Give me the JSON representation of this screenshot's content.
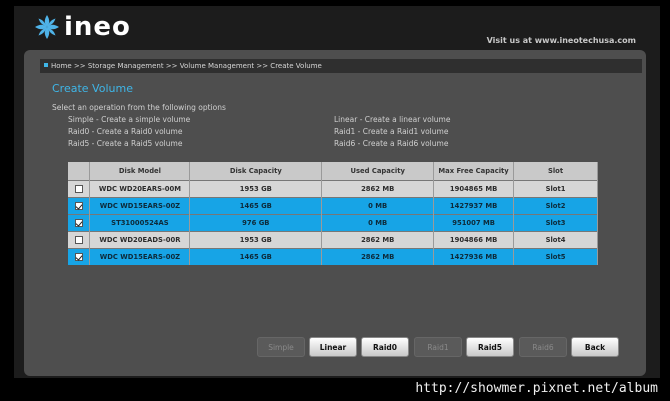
{
  "brand": {
    "logo_text": "ineo",
    "visit_text": "Visit us at www.ineotechusa.com"
  },
  "breadcrumb": "Home >> Storage Management >> Volume Management >> Create Volume",
  "page_title": "Create Volume",
  "instruction": "Select an operation from the following options",
  "options": {
    "simple": "Simple - Create a simple volume",
    "raid0": "Raid0 - Create a Raid0 volume",
    "raid5": "Raid5 - Create a Raid5 volume",
    "linear": "Linear - Create a linear volume",
    "raid1": "Raid1 - Create a Raid1 volume",
    "raid6": "Raid6 - Create a Raid6 volume"
  },
  "table": {
    "headers": [
      "Disk Model",
      "Disk Capacity",
      "Used Capacity",
      "Max Free Capacity",
      "Slot"
    ],
    "rows": [
      {
        "checked": false,
        "model": "WDC WD20EARS-00M",
        "capacity": "1953 GB",
        "used": "2862 MB",
        "free": "1904865 MB",
        "slot": "Slot1"
      },
      {
        "checked": true,
        "model": "WDC WD15EARS-00Z",
        "capacity": "1465 GB",
        "used": "0 MB",
        "free": "1427937 MB",
        "slot": "Slot2"
      },
      {
        "checked": true,
        "model": "ST31000524AS",
        "capacity": "976 GB",
        "used": "0 MB",
        "free": "951007 MB",
        "slot": "Slot3"
      },
      {
        "checked": false,
        "model": "WDC WD20EADS-00R",
        "capacity": "1953 GB",
        "used": "2862 MB",
        "free": "1904866 MB",
        "slot": "Slot4"
      },
      {
        "checked": true,
        "model": "WDC WD15EARS-00Z",
        "capacity": "1465 GB",
        "used": "2862 MB",
        "free": "1427936 MB",
        "slot": "Slot5"
      }
    ]
  },
  "buttons": {
    "simple": "Simple",
    "linear": "Linear",
    "raid0": "Raid0",
    "raid1": "Raid1",
    "raid5": "Raid5",
    "raid6": "Raid6",
    "back": "Back"
  },
  "watermark": "http://showmer.pixnet.net/album",
  "colors": {
    "accent": "#17a4e6",
    "panel": "#4e4e4e",
    "row_unselected": "#d6d6d6"
  }
}
